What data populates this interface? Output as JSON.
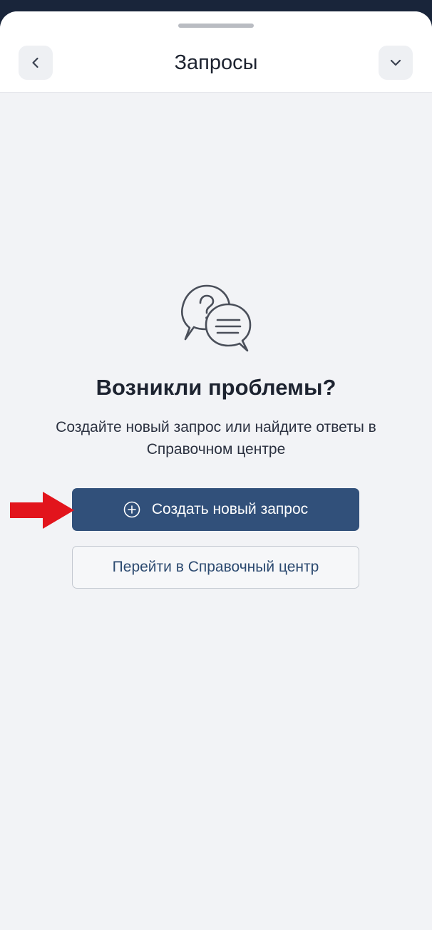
{
  "header": {
    "title": "Запросы",
    "back_icon": "chevron-left-icon",
    "collapse_icon": "chevron-down-icon"
  },
  "empty_state": {
    "icon": "chat-question-icon",
    "heading": "Возникли проблемы?",
    "description": "Создайте новый запрос или найдите ответы в Справочном центре"
  },
  "actions": {
    "create_request_label": "Создать новый запрос",
    "create_request_icon": "plus-circle-icon",
    "help_center_label": "Перейти в Справочный центр"
  },
  "annotation": {
    "arrow_icon": "red-arrow-icon",
    "arrow_color": "#e2141c"
  },
  "colors": {
    "primary_button": "#31507a",
    "background": "#f2f3f6",
    "status_bar": "#19253a"
  }
}
